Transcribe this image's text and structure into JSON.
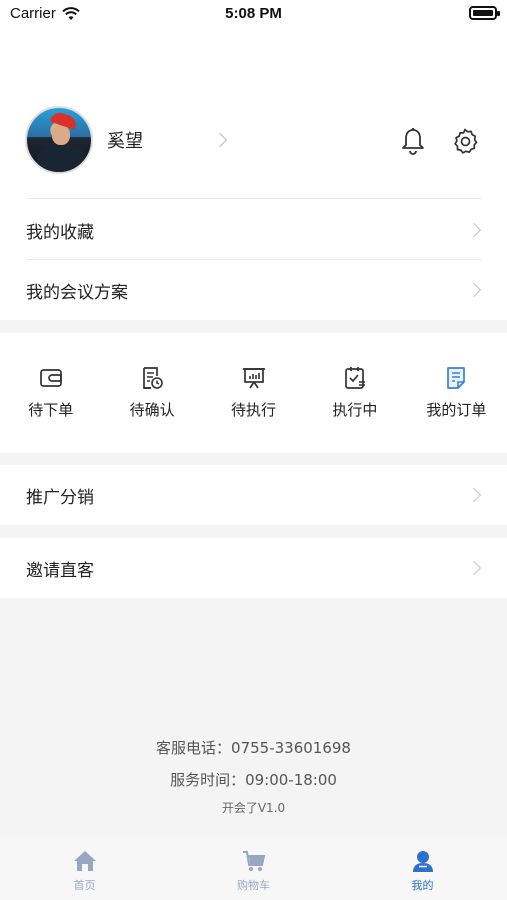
{
  "status_bar": {
    "carrier": "Carrier",
    "time": "5:08 PM"
  },
  "profile": {
    "name": "奚望"
  },
  "menu": {
    "favorites": "我的收藏",
    "meeting_plans": "我的会议方案",
    "promotion": "推广分销",
    "invite": "邀请直客"
  },
  "orders": [
    {
      "label": "待下单",
      "icon": "wallet-icon"
    },
    {
      "label": "待确认",
      "icon": "document-clock-icon"
    },
    {
      "label": "待执行",
      "icon": "presentation-board-icon"
    },
    {
      "label": "执行中",
      "icon": "clipboard-check-icon"
    },
    {
      "label": "我的订单",
      "icon": "order-list-icon"
    }
  ],
  "footer": {
    "phone": "客服电话：0755-33601698",
    "hours": "服务时间：09:00-18:00",
    "version": "开会了V1.0"
  },
  "tabs": [
    {
      "label": "首页",
      "icon": "home-icon",
      "active": false
    },
    {
      "label": "购物车",
      "icon": "cart-icon",
      "active": false
    },
    {
      "label": "我的",
      "icon": "person-icon",
      "active": true
    }
  ],
  "colors": {
    "accent": "#2f6fce",
    "inactive_tab": "#9aa7c2",
    "background": "#f4f4f5"
  }
}
